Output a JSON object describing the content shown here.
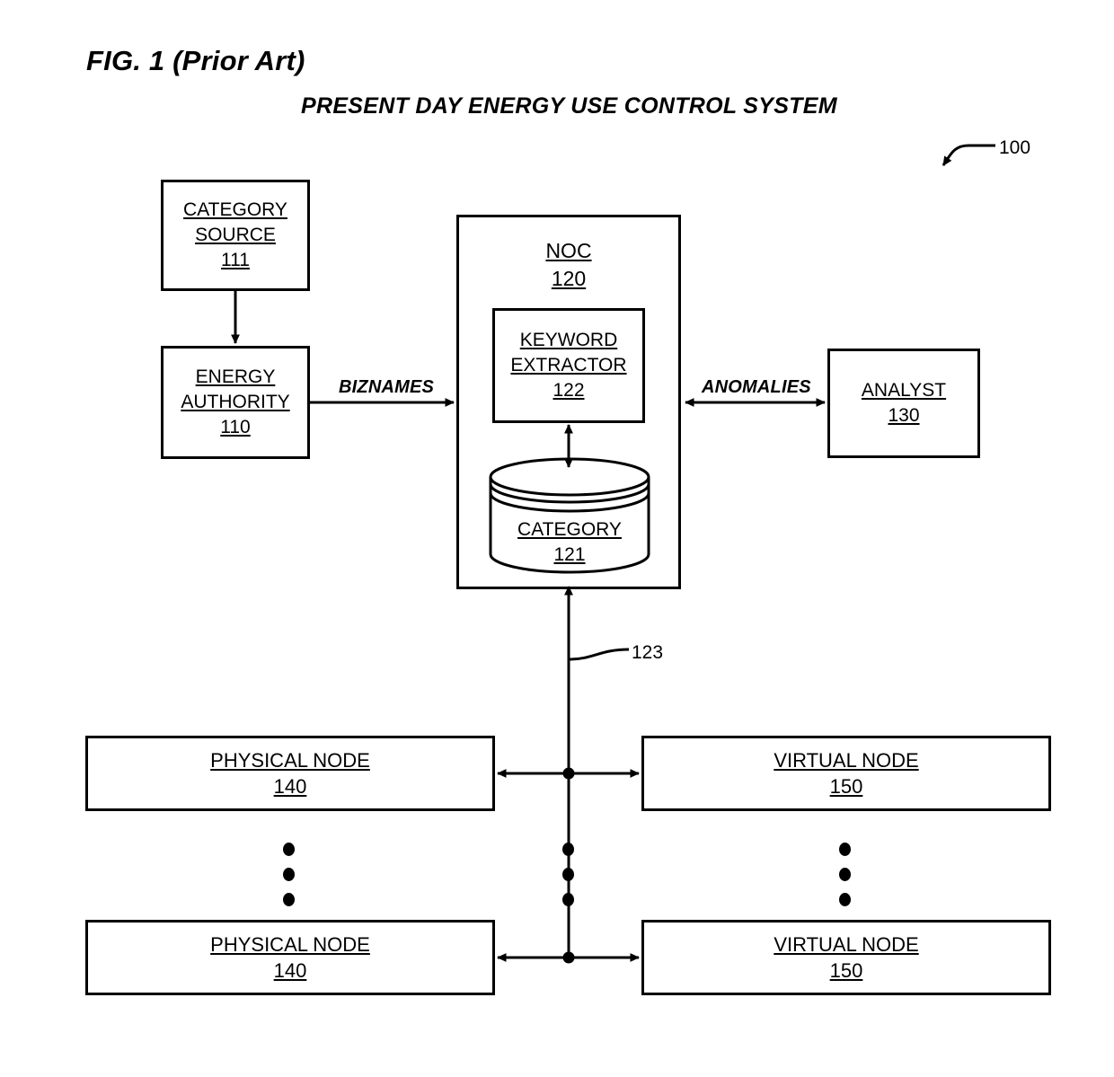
{
  "figure": {
    "label": "FIG. 1 (Prior Art)",
    "subtitle": "PRESENT DAY ENERGY USE CONTROL SYSTEM",
    "system_ref": "100",
    "bus_ref": "123"
  },
  "nodes": {
    "category_source": {
      "name": "CATEGORY",
      "name2": "SOURCE",
      "ref": "111"
    },
    "energy_authority": {
      "name": "ENERGY",
      "name2": "AUTHORITY",
      "ref": "110"
    },
    "noc": {
      "name": "NOC",
      "ref": "120"
    },
    "keyword_extractor": {
      "name": "KEYWORD",
      "name2": "EXTRACTOR",
      "ref": "122"
    },
    "category_db": {
      "name": "CATEGORY",
      "ref": "121"
    },
    "analyst": {
      "name": "ANALYST",
      "ref": "130"
    },
    "physical_node_1": {
      "name": "PHYSICAL NODE",
      "ref": "140"
    },
    "physical_node_2": {
      "name": "PHYSICAL NODE",
      "ref": "140"
    },
    "virtual_node_1": {
      "name": "VIRTUAL NODE",
      "ref": "150"
    },
    "virtual_node_2": {
      "name": "VIRTUAL NODE",
      "ref": "150"
    }
  },
  "edges": {
    "biznames": "BIZNAMES",
    "anomalies": "ANOMALIES"
  },
  "colors": {
    "stroke": "#000000",
    "background": "#ffffff"
  }
}
